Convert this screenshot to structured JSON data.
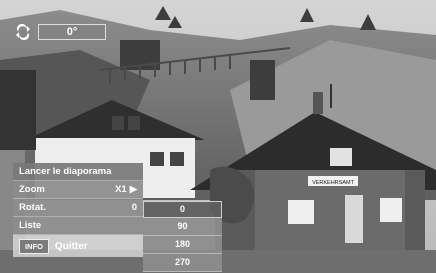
{
  "rotation_indicator": {
    "icon": "rotate-icon",
    "value": "0°"
  },
  "menu": {
    "title": "Lancer le diaporama",
    "rows": [
      {
        "label": "Zoom",
        "value": "X1",
        "arrow": "▶"
      },
      {
        "label": "Rotat.",
        "value": "0"
      },
      {
        "label": "Liste",
        "value": ""
      }
    ],
    "footer": {
      "badge": "INFO",
      "label": "Quitter"
    }
  },
  "rotation_options": {
    "options": [
      "0",
      "90",
      "180",
      "270"
    ],
    "selected": "0"
  },
  "photo": {
    "sign_text": "VERKEHRSAMT"
  }
}
